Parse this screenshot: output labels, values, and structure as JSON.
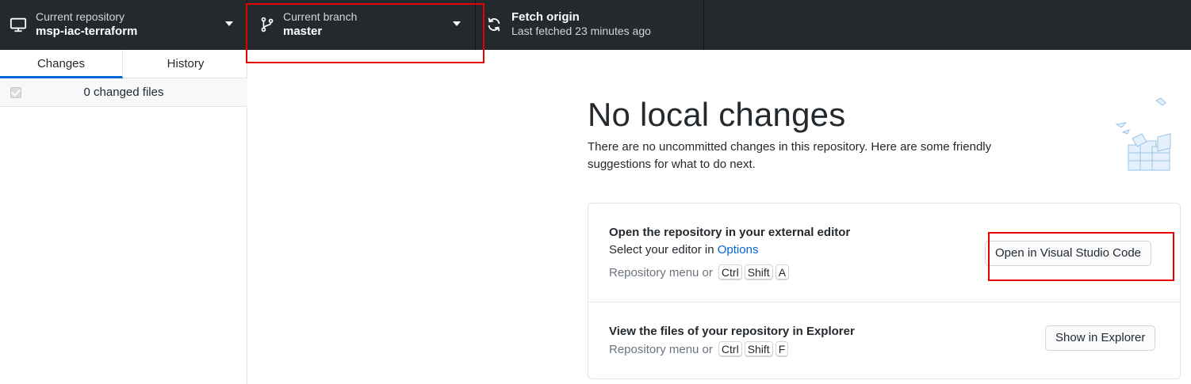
{
  "toolbar": {
    "repo": {
      "title": "Current repository",
      "value": "msp-iac-terraform"
    },
    "branch": {
      "title": "Current branch",
      "value": "master"
    },
    "fetch": {
      "title": "Fetch origin",
      "value": "Last fetched 23 minutes ago"
    }
  },
  "sidebar": {
    "tabs": [
      {
        "label": "Changes",
        "selected": true
      },
      {
        "label": "History",
        "selected": false
      }
    ],
    "changed_files": "0 changed files"
  },
  "main": {
    "heading": "No local changes",
    "subtext": "There are no uncommitted changes in this repository. Here are some friendly suggestions for what to do next.",
    "editor": {
      "title": "Open the repository in your external editor",
      "desc_prefix": "Select your editor in ",
      "desc_link": "Options",
      "menu_prefix": "Repository menu or",
      "keys": [
        "Ctrl",
        "Shift",
        "A"
      ],
      "button": "Open in Visual Studio Code"
    },
    "explorer": {
      "title": "View the files of your repository in Explorer",
      "menu_prefix": "Repository menu or",
      "keys": [
        "Ctrl",
        "Shift",
        "F"
      ],
      "button": "Show in Explorer"
    }
  },
  "colors": {
    "accent": "#0366d6",
    "highlight": "#e60000",
    "toolbar_bg": "#24292e"
  }
}
